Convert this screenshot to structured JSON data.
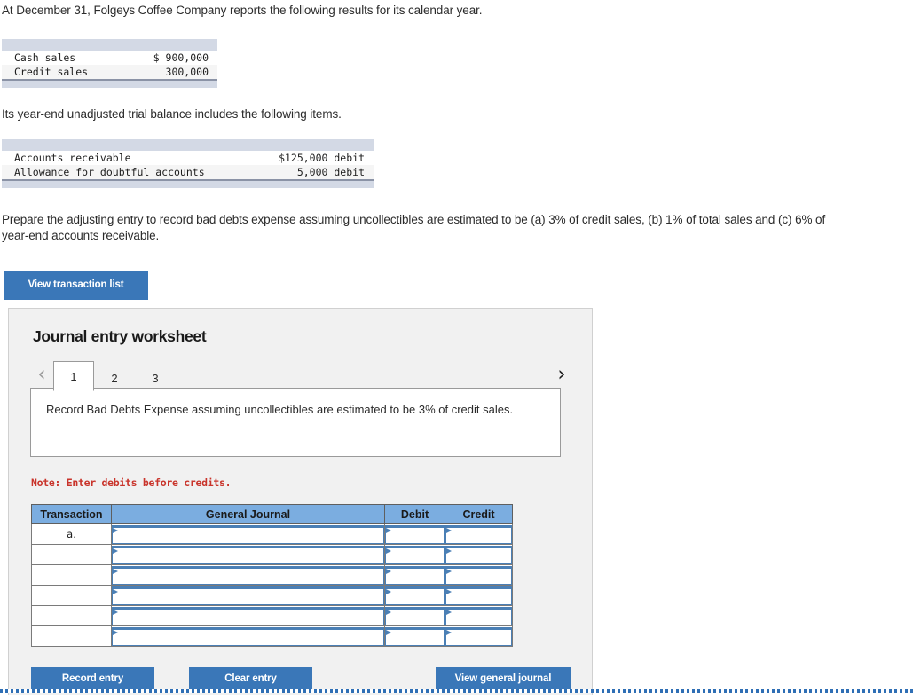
{
  "intro": {
    "text": "At December 31, Folgeys Coffee Company reports the following results for its calendar year."
  },
  "sales_table": {
    "rows": [
      {
        "label": "Cash sales",
        "value": "$ 900,000"
      },
      {
        "label": "Credit sales",
        "value": "300,000"
      }
    ]
  },
  "trial_balance_intro": {
    "text": "Its year-end unadjusted trial balance includes the following items."
  },
  "trial_balance_table": {
    "rows": [
      {
        "label": "Accounts receivable",
        "value": "$125,000 debit"
      },
      {
        "label": "Allowance for doubtful accounts",
        "value": "5,000 debit"
      }
    ]
  },
  "task": {
    "text": "Prepare the adjusting entry to record bad debts expense assuming uncollectibles are estimated to be (a) 3% of credit sales, (b) 1% of total sales and (c) 6% of year-end accounts receivable."
  },
  "view_transaction_list_button": {
    "label": "View transaction list"
  },
  "worksheet": {
    "title": "Journal entry worksheet",
    "prev_icon": "‹",
    "next_icon": "›",
    "tabs": [
      {
        "label": "1",
        "active": true
      },
      {
        "label": "2",
        "active": false
      },
      {
        "label": "3",
        "active": false
      }
    ],
    "description": "Record Bad Debts Expense assuming uncollectibles are estimated to be 3% of credit sales.",
    "note": "Note: Enter debits before credits.",
    "table": {
      "headers": [
        "Transaction",
        "General Journal",
        "Debit",
        "Credit"
      ],
      "rows": [
        {
          "transaction": "a.",
          "general_journal": "",
          "debit": "",
          "credit": ""
        },
        {
          "transaction": "",
          "general_journal": "",
          "debit": "",
          "credit": ""
        },
        {
          "transaction": "",
          "general_journal": "",
          "debit": "",
          "credit": ""
        },
        {
          "transaction": "",
          "general_journal": "",
          "debit": "",
          "credit": ""
        },
        {
          "transaction": "",
          "general_journal": "",
          "debit": "",
          "credit": ""
        },
        {
          "transaction": "",
          "general_journal": "",
          "debit": "",
          "credit": ""
        }
      ]
    },
    "actions": {
      "record_entry": "Record entry",
      "clear_entry": "Clear entry",
      "view_general_journal": "View general journal"
    }
  },
  "colors": {
    "button_blue": "#3a77b8",
    "table_header_blue": "#7bade0",
    "cell_border_blue": "#4a7fb5",
    "data_band": "#d3d9e5",
    "note_red": "#c9342b",
    "panel_background": "#f1f1f1"
  }
}
